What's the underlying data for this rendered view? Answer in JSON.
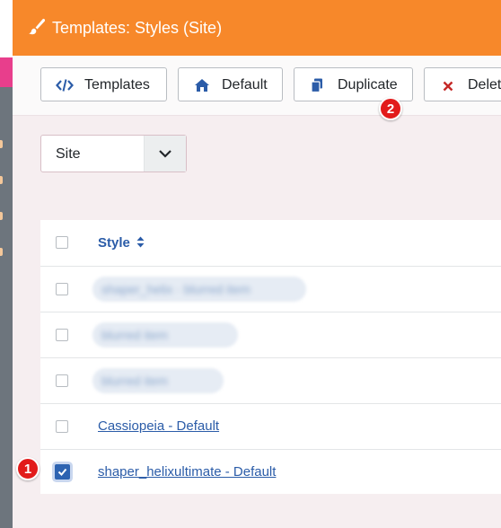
{
  "header": {
    "title": "Templates: Styles (Site)",
    "color": "#f7882a"
  },
  "toolbar": {
    "buttons": [
      {
        "label": "Templates",
        "icon": "code-icon"
      },
      {
        "label": "Default",
        "icon": "home-icon"
      },
      {
        "label": "Duplicate",
        "icon": "copy-icon"
      },
      {
        "label": "Delet",
        "icon": "times-icon"
      }
    ]
  },
  "filter": {
    "client_select_value": "Site"
  },
  "table": {
    "column_header": "Style",
    "rows": [
      {
        "label": "shaper_helix · blurred item",
        "blurred": true,
        "checked": false
      },
      {
        "label": "blurred item",
        "blurred": true,
        "checked": false
      },
      {
        "label": "blurred item",
        "blurred": true,
        "checked": false
      },
      {
        "label": "Cassiopeia - Default",
        "blurred": false,
        "checked": false
      },
      {
        "label": "shaper_helixultimate - Default",
        "blurred": false,
        "checked": true
      }
    ]
  },
  "annotations": {
    "step1": "1",
    "step2": "2"
  },
  "colors": {
    "link": "#2b5ca8",
    "badge": "#e21b1b",
    "accent_pink": "#e83e8c"
  }
}
